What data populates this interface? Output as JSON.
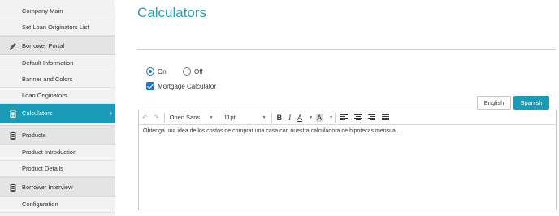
{
  "sidebar": {
    "items": [
      {
        "label": "Company Main",
        "type": "sub"
      },
      {
        "label": "Set Loan Originators List",
        "type": "sub"
      },
      {
        "label": "Borrower Portal",
        "type": "head",
        "icon": "pen-icon"
      },
      {
        "label": "Default Information",
        "type": "sub"
      },
      {
        "label": "Banner and Colors",
        "type": "sub"
      },
      {
        "label": "Loan Originators",
        "type": "sub"
      },
      {
        "label": "Calculators",
        "type": "head-active",
        "icon": "calculator-icon"
      },
      {
        "label": "Products",
        "type": "head",
        "icon": "document-icon"
      },
      {
        "label": "Product Introduction",
        "type": "sub"
      },
      {
        "label": "Product Details",
        "type": "sub"
      },
      {
        "label": "Borrower Interview",
        "type": "head",
        "icon": "document-icon"
      },
      {
        "label": "Configuration",
        "type": "sub"
      }
    ],
    "active_chevron": "›"
  },
  "main": {
    "title": "Calculators",
    "status": {
      "on_label": "On",
      "off_label": "Off",
      "selected": "On"
    },
    "mortgage_calculator": {
      "label": "Mortgage Calculator",
      "checked": true
    },
    "languages": {
      "english": "English",
      "spanish": "Spanish",
      "active": "Spanish"
    },
    "editor": {
      "font_family": "Open Sans",
      "font_size": "11pt",
      "bold": "B",
      "italic": "I",
      "font_color": "A",
      "highlight": "A",
      "undo_icon": "↶",
      "redo_icon": "↷",
      "content": "Obtenga una idea de los costos de comprar una casa con nuestra calculadora de hipotecas mensual."
    }
  },
  "colors": {
    "accent": "#1a9bb8",
    "checkbox": "#1e73be"
  }
}
